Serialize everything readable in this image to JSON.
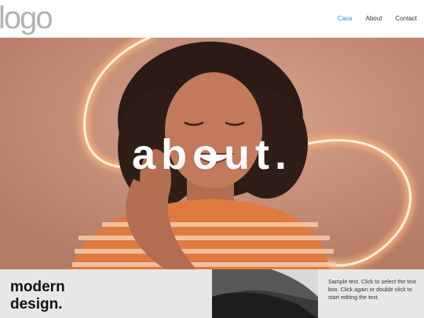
{
  "header": {
    "logo_text": "logo",
    "nav": {
      "home": "Casa",
      "about": "About",
      "contact": "Contact"
    },
    "active_color": "#3f8fd1"
  },
  "hero": {
    "title": "about."
  },
  "footer_panels": {
    "heading": "modern\ndesign.",
    "sample_text": "Sample text. Click to select the text box. Click again or double click to start editing the text."
  }
}
